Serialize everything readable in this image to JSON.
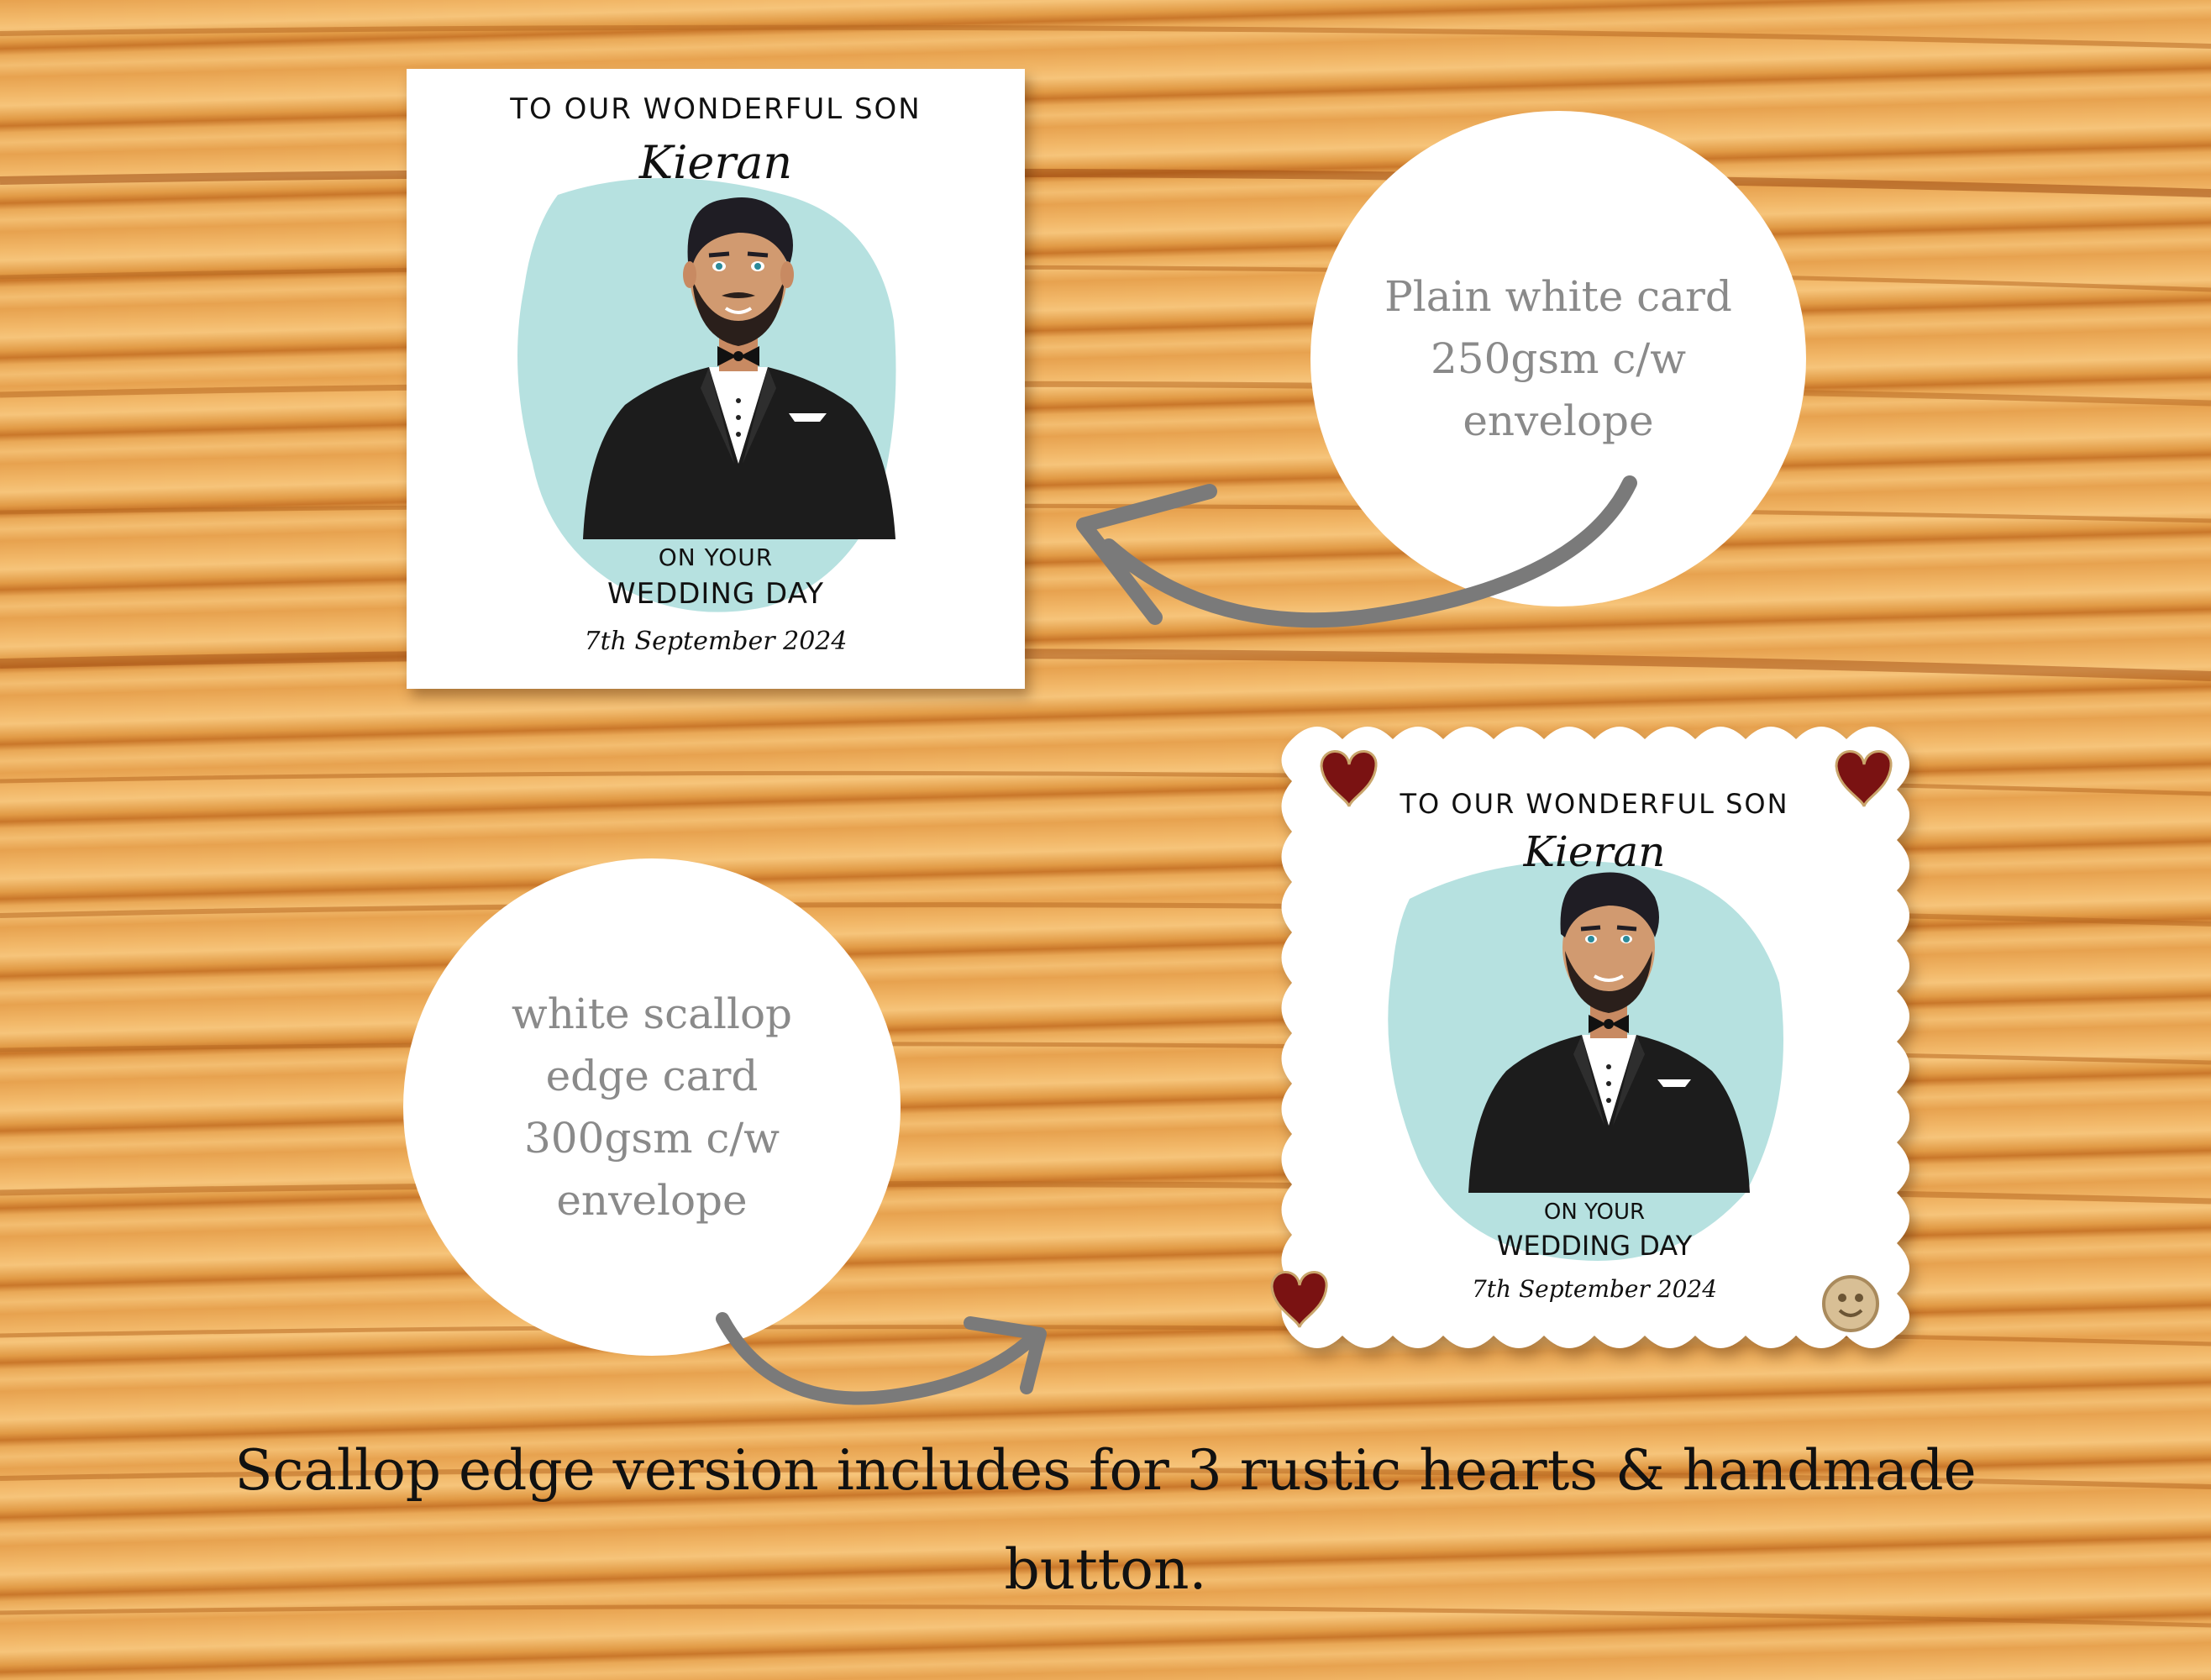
{
  "card_plain": {
    "line1": "TO OUR WONDERFUL SON",
    "name": "Kieran",
    "line3": "ON YOUR",
    "line4": "WEDDING DAY",
    "date": "7th September 2024"
  },
  "card_scallop": {
    "line1": "TO OUR WONDERFUL SON",
    "name": "Kieran",
    "line3": "ON YOUR",
    "line4": "WEDDING DAY",
    "date": "7th September 2024"
  },
  "bubble_plain": {
    "lines": [
      "Plain white card",
      "250gsm c/w",
      "envelope"
    ]
  },
  "bubble_scallop": {
    "lines": [
      "white scallop",
      "edge card",
      "300gsm c/w",
      "envelope"
    ]
  },
  "footer": {
    "line1": "Scallop edge version includes for 3 rustic hearts & handmade",
    "line2": "button."
  },
  "colors": {
    "wood": "#e7a24f",
    "watercolor": "#a9dcdb",
    "arrow": "#7a7a7a",
    "heart": "#7a1212",
    "bubble_text": "#8a8a8a"
  }
}
